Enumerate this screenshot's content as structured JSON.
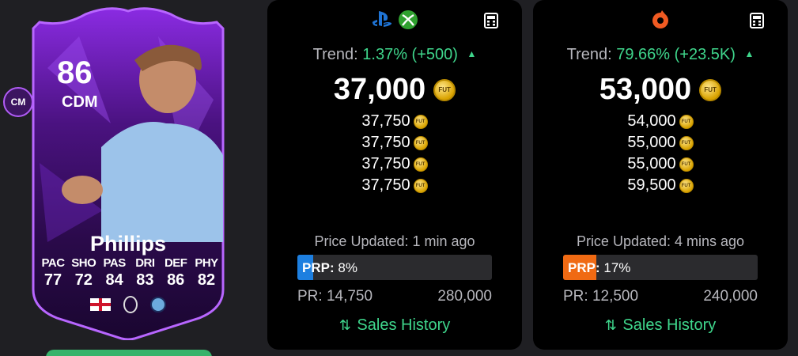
{
  "card": {
    "rating": "86",
    "position": "CDM",
    "alt_position": "CM",
    "name": "Phillips",
    "stats": [
      {
        "label": "PAC",
        "value": "77"
      },
      {
        "label": "SHO",
        "value": "72"
      },
      {
        "label": "PAS",
        "value": "84"
      },
      {
        "label": "DRI",
        "value": "83"
      },
      {
        "label": "DEF",
        "value": "86"
      },
      {
        "label": "PHY",
        "value": "82"
      }
    ]
  },
  "coin_icon_text": "FUT",
  "console": {
    "trend_label": "Trend:",
    "trend_value": "1.37% (+500)",
    "trend_arrow": "▲",
    "main_price": "37,000",
    "prices": [
      "37,750",
      "37,750",
      "37,750",
      "37,750"
    ],
    "updated": "Price Updated: 1 min ago",
    "prp_label": "PRP:",
    "prp_value": "8%",
    "prp_percent": 8,
    "prp_color": "#1d7fe0",
    "pr_min": "PR: 14,750",
    "pr_max": "280,000",
    "sales_label": "Sales History"
  },
  "pc": {
    "trend_label": "Trend:",
    "trend_value": "79.66% (+23.5K)",
    "trend_arrow": "▲",
    "main_price": "53,000",
    "prices": [
      "54,000",
      "55,000",
      "55,000",
      "59,500"
    ],
    "updated": "Price Updated: 4 mins ago",
    "prp_label": "PRP:",
    "prp_value": "17%",
    "prp_percent": 17,
    "prp_color": "#f06a13",
    "pr_min": "PR: 12,500",
    "pr_max": "240,000",
    "sales_label": "Sales History"
  },
  "colors": {
    "trend_green": "#3fd68c",
    "card_purple": "#7a22c9",
    "panel_bg": "#000000"
  },
  "icons": [
    "playstation-icon",
    "xbox-icon",
    "origin-icon",
    "calculator-icon",
    "sort-icon",
    "coin-icon"
  ]
}
